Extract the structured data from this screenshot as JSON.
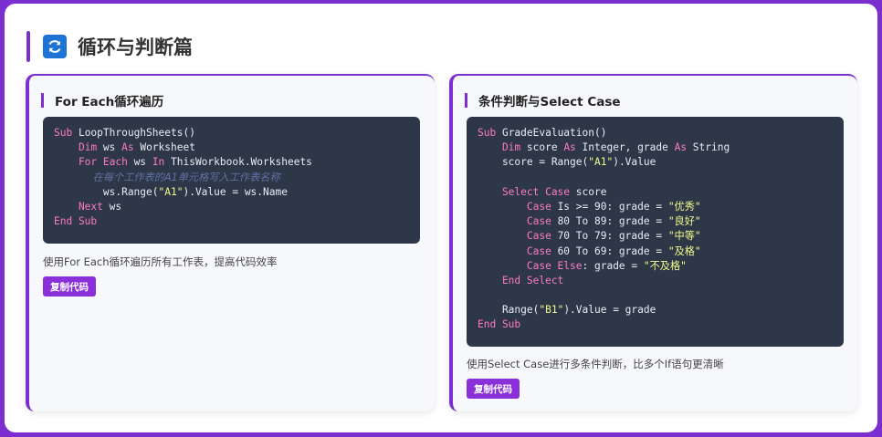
{
  "section": {
    "title": "循环与判断篇",
    "icon": "refresh-icon",
    "icon_color": "#1e74d4",
    "accent": "#7b2fd0"
  },
  "cards": [
    {
      "title": "For Each循环遍历",
      "code_lines": [
        [
          {
            "t": "Sub ",
            "c": "kw"
          },
          {
            "t": "LoopThroughSheets()",
            "c": ""
          }
        ],
        [
          {
            "t": "    Dim ",
            "c": "kw"
          },
          {
            "t": "ws ",
            "c": ""
          },
          {
            "t": "As ",
            "c": "kw"
          },
          {
            "t": "Worksheet",
            "c": ""
          }
        ],
        [
          {
            "t": "    For Each ",
            "c": "kw"
          },
          {
            "t": "ws ",
            "c": ""
          },
          {
            "t": "In ",
            "c": "kw"
          },
          {
            "t": "ThisWorkbook.Worksheets",
            "c": ""
          }
        ],
        [
          {
            "t": "            在每个工作表的A1单元格写入工作表名称",
            "c": "cmt"
          }
        ],
        [
          {
            "t": "        ws.Range(",
            "c": ""
          },
          {
            "t": "\"A1\"",
            "c": "str"
          },
          {
            "t": ").Value = ws.Name",
            "c": ""
          }
        ],
        [
          {
            "t": "    Next ",
            "c": "kw"
          },
          {
            "t": "ws",
            "c": ""
          }
        ],
        [
          {
            "t": "End Sub",
            "c": "kw"
          }
        ]
      ],
      "description": "使用For Each循环遍历所有工作表，提高代码效率",
      "button_label": "复制代码"
    },
    {
      "title": "条件判断与Select Case",
      "code_lines": [
        [
          {
            "t": "Sub ",
            "c": "kw"
          },
          {
            "t": "GradeEvaluation()",
            "c": ""
          }
        ],
        [
          {
            "t": "    Dim ",
            "c": "kw"
          },
          {
            "t": "score ",
            "c": ""
          },
          {
            "t": "As ",
            "c": "kw"
          },
          {
            "t": "Integer, grade ",
            "c": ""
          },
          {
            "t": "As ",
            "c": "kw"
          },
          {
            "t": "String",
            "c": ""
          }
        ],
        [
          {
            "t": "    score = Range(",
            "c": ""
          },
          {
            "t": "\"A1\"",
            "c": "str"
          },
          {
            "t": ").Value",
            "c": ""
          }
        ],
        [
          {
            "t": "",
            "c": ""
          }
        ],
        [
          {
            "t": "    Select Case ",
            "c": "kw"
          },
          {
            "t": "score",
            "c": ""
          }
        ],
        [
          {
            "t": "        Case ",
            "c": "kw"
          },
          {
            "t": "Is >= 90: grade = ",
            "c": ""
          },
          {
            "t": "\"优秀\"",
            "c": "str"
          }
        ],
        [
          {
            "t": "        Case ",
            "c": "kw"
          },
          {
            "t": "80 To 89: grade = ",
            "c": ""
          },
          {
            "t": "\"良好\"",
            "c": "str"
          }
        ],
        [
          {
            "t": "        Case ",
            "c": "kw"
          },
          {
            "t": "70 To 79: grade = ",
            "c": ""
          },
          {
            "t": "\"中等\"",
            "c": "str"
          }
        ],
        [
          {
            "t": "        Case ",
            "c": "kw"
          },
          {
            "t": "60 To 69: grade = ",
            "c": ""
          },
          {
            "t": "\"及格\"",
            "c": "str"
          }
        ],
        [
          {
            "t": "        Case Else",
            "c": "kw"
          },
          {
            "t": ": grade = ",
            "c": ""
          },
          {
            "t": "\"不及格\"",
            "c": "str"
          }
        ],
        [
          {
            "t": "    End Select",
            "c": "kw"
          }
        ],
        [
          {
            "t": "",
            "c": ""
          }
        ],
        [
          {
            "t": "    Range(",
            "c": ""
          },
          {
            "t": "\"B1\"",
            "c": "str"
          },
          {
            "t": ").Value = grade",
            "c": ""
          }
        ],
        [
          {
            "t": "End Sub",
            "c": "kw"
          }
        ]
      ],
      "description": "使用Select Case进行多条件判断，比多个If语句更清晰",
      "button_label": "复制代码"
    }
  ]
}
